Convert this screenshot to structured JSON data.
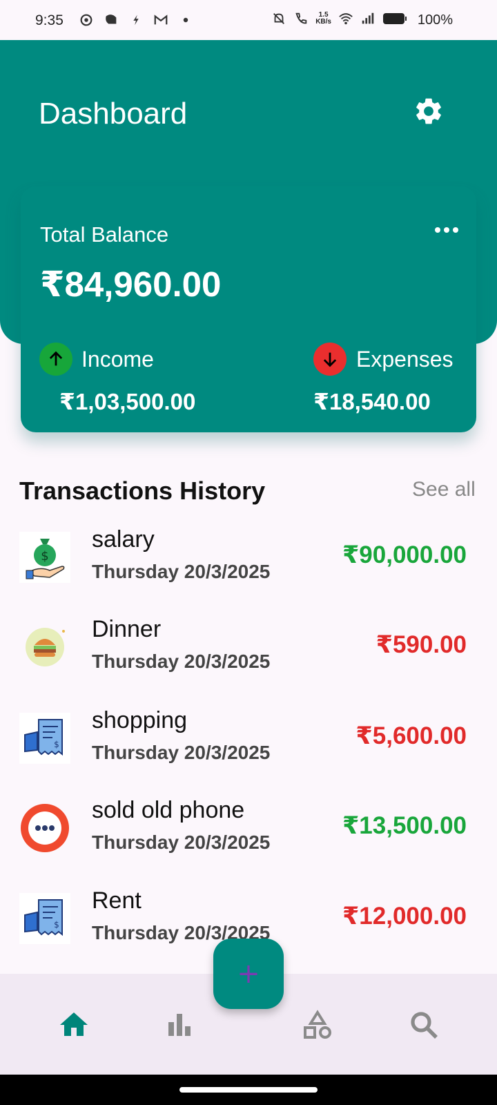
{
  "status_bar": {
    "time": "9:35",
    "net_speed_top": "1.5",
    "net_speed_bottom": "KB/s",
    "battery_percent": "100%"
  },
  "header": {
    "title": "Dashboard"
  },
  "balance_card": {
    "label": "Total Balance",
    "value": "₹84,960.00",
    "income_label": "Income",
    "income_value": "₹1,03,500.00",
    "expenses_label": "Expenses",
    "expenses_value": "₹18,540.00"
  },
  "transactions": {
    "title": "Transactions History",
    "see_all": "See all",
    "items": [
      {
        "name": "salary",
        "date": "Thursday  20/3/2025",
        "amount": "₹90,000.00",
        "type": "income",
        "icon": "money-bag-icon"
      },
      {
        "name": "Dinner",
        "date": "Thursday  20/3/2025",
        "amount": "₹590.00",
        "type": "expense",
        "icon": "burger-icon"
      },
      {
        "name": "shopping",
        "date": "Thursday  20/3/2025",
        "amount": "₹5,600.00",
        "type": "expense",
        "icon": "receipt-icon"
      },
      {
        "name": "sold old phone",
        "date": "Thursday  20/3/2025",
        "amount": "₹13,500.00",
        "type": "income",
        "icon": "more-circle-icon"
      },
      {
        "name": "Rent",
        "date": "Thursday  20/3/2025",
        "amount": "₹12,000.00",
        "type": "expense",
        "icon": "receipt-icon"
      }
    ]
  },
  "fab": {
    "label": "+"
  },
  "colors": {
    "primary": "#008a80",
    "income": "#19a63b",
    "expense": "#e12a2a"
  }
}
